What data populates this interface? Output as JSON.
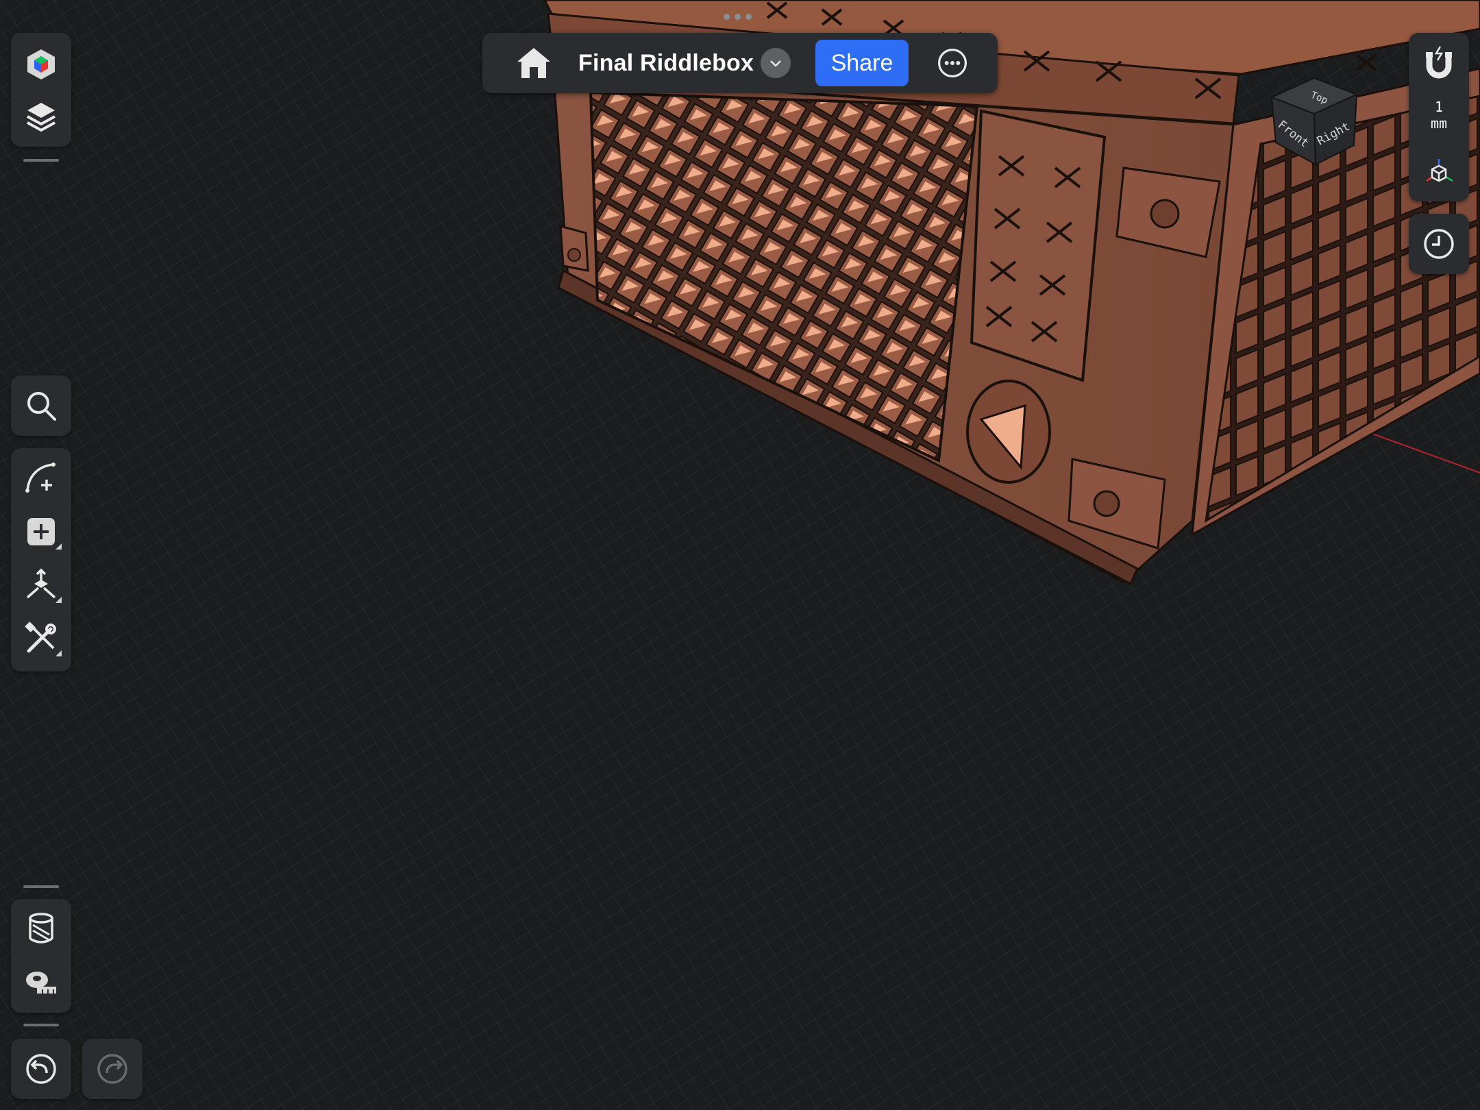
{
  "app": {
    "document_title": "Final Riddlebox",
    "share_label": "Share"
  },
  "left_toolbar": {
    "top_group": [
      "appearance-icon",
      "layers-icon"
    ],
    "middle_search": "search-icon",
    "middle_group": [
      "sketch-icon",
      "add-primitive-icon",
      "transform-icon",
      "tools-icon"
    ],
    "bottom_group": [
      "section-view-icon",
      "measure-icon"
    ],
    "history": [
      "undo-icon",
      "redo-icon"
    ]
  },
  "right_toolbar": {
    "snap_icon": "magnet-icon",
    "grid_unit_value": "1",
    "grid_unit": "mm",
    "view_icon": "axis-cube-icon",
    "history_icon": "clock-icon"
  },
  "view_cube": {
    "top": "Top",
    "front": "Front",
    "right": "Right"
  },
  "colors": {
    "accent": "#2e6df6",
    "panel": "#2b2c2f",
    "background": "#1b1c1e",
    "model": "#8c5440"
  }
}
